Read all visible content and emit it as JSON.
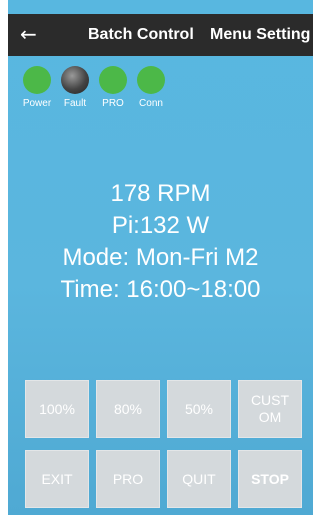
{
  "header": {
    "back_icon": "arrow-left-icon",
    "menu_items": [
      "Batch Control",
      "Menu Setting"
    ]
  },
  "indicators": [
    {
      "label": "Power",
      "color": "#4cb848"
    },
    {
      "label": "Fault",
      "color": "#333333"
    },
    {
      "label": "PRO",
      "color": "#4cb848"
    },
    {
      "label": "Conn",
      "color": "#4cb848"
    }
  ],
  "status": {
    "speed": "178 RPM",
    "power": "Pi:132 W",
    "mode": "Mode: Mon-Fri M2",
    "time": "Time: 16:00~18:00"
  },
  "buttons": {
    "row1": [
      "100%",
      "80%",
      "50%",
      "CUST OM"
    ],
    "row2": [
      "EXIT",
      "PRO",
      "QUIT",
      "STOP"
    ]
  },
  "colors": {
    "background": "#5bb6de",
    "topbar": "#2b2b2b",
    "indicator_on": "#4cb848",
    "button": "#d4d9dc"
  }
}
